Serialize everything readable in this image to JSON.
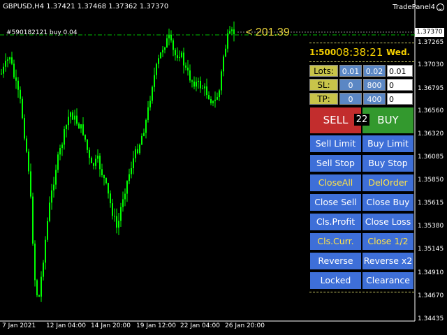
{
  "header": {
    "symbol_info": "GBPUSD,H4  1.37421 1.37468 1.37362 1.37370",
    "brand": "TradePanel4"
  },
  "chart": {
    "order_label": "#590182121 buy 0.04",
    "pips_label": "< 201.39",
    "current_price": "1.37370",
    "price_axis": [
      "1.37265",
      "1.37030",
      "1.36795",
      "1.36560",
      "1.36320",
      "1.36085",
      "1.35850",
      "1.35615",
      "1.35380",
      "1.35145",
      "1.34910",
      "1.34670",
      "1.34435"
    ],
    "date_axis": [
      "7 Jan 2021",
      "12 Jan 04:00",
      "14 Jan 20:00",
      "19 Jan 12:00",
      "22 Jan 04:00",
      "26 Jan 20:00"
    ],
    "colors": {
      "candles": "#00ff00",
      "order_line": "#00c000",
      "background": "#000000"
    }
  },
  "panel": {
    "leverage": "1:500",
    "time": "08:38:21",
    "day": "Wed.",
    "lots": {
      "label": "Lots:",
      "preset1": "0.01",
      "preset2": "0.02",
      "value": "0.01"
    },
    "sl": {
      "label": "SL:",
      "preset1": "0",
      "preset2": "800",
      "value": "0"
    },
    "tp": {
      "label": "TP:",
      "preset1": "0",
      "preset2": "400",
      "value": "0"
    },
    "sell_label": "SELL",
    "buy_label": "BUY",
    "spread": "22",
    "buttons": {
      "sell_limit": "Sell Limit",
      "buy_limit": "Buy Limit",
      "sell_stop": "Sell Stop",
      "buy_stop": "Buy Stop",
      "close_all": "CloseAll",
      "del_order": "DelOrder",
      "close_sell": "Close Sell",
      "close_buy": "Close Buy",
      "cls_profit": "Cls.Profit",
      "close_loss": "Close Loss",
      "cls_curr": "Cls.Curr.",
      "close_half": "Close 1/2",
      "reverse": "Reverse",
      "reverse_x2": "Reverse x2",
      "locked": "Locked",
      "clearance": "Clearance"
    }
  }
}
